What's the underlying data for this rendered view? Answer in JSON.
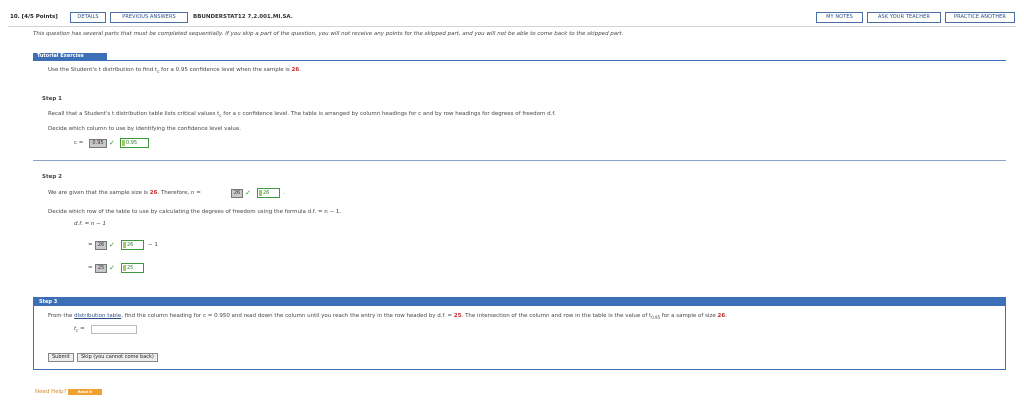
{
  "header": {
    "question_number": "10. [4/5 Points]",
    "details_label": "DETAILS",
    "previous_answers_label": "PREVIOUS ANSWERS",
    "question_id": "BBUNDERSTAT12 7.2.001.MI.SA.",
    "my_notes_label": "MY NOTES",
    "ask_teacher_label": "ASK YOUR TEACHER",
    "practice_another_label": "PRACTICE ANOTHER"
  },
  "notice": "This question has several parts that must be completed sequentially. If you skip a part of the question, you will not receive any points for the skipped part, and you will not be able to come back to the skipped part.",
  "tutorial": {
    "label": "Tutorial Exercise",
    "prompt_prefix": "Use the Student's t distribution to find t",
    "prompt_sub": "c",
    "prompt_mid": " for a 0.95 confidence level when the sample is ",
    "sample": "26",
    "prompt_suffix": "."
  },
  "step1": {
    "title": "Step 1",
    "line1_prefix": "Recall that a Student's t distribution table lists critical values t",
    "line1_sub": "c",
    "line1_suffix": " for a c confidence level. The table is arranged by column headings for c and by row headings for degrees of freedom d.f.",
    "line2": "Decide which column to use by identifying the confidence level value.",
    "c_label": "c =",
    "c_entered": "0.95",
    "c_correct": "0.95"
  },
  "step2": {
    "title": "Step 2",
    "line1_prefix": "We are given that the sample size is ",
    "sample": "26",
    "line1_mid": ". Therefore, n =",
    "n_entered": "26",
    "n_correct": "26",
    "line1_end": ".",
    "line2": "Decide which row of the table to use by calculating the degrees of freedom using the formula d.f. = n − 1.",
    "formula": "d.f. = n − 1",
    "eq_sign": "=",
    "n_entered2": "26",
    "n_correct2": "26",
    "minus_one": "− 1",
    "df_entered": "25",
    "df_correct": "25"
  },
  "step3": {
    "title": "Step 3",
    "line1_prefix": "From the ",
    "link": "distribution table",
    "line1_mid": ", find the column heading for c = 0.950 and read down the column until you reach the entry in the row headed by d.f. = ",
    "df": "25",
    "line1_mid2": ". The intersection of the column and row in the table is the value of t",
    "t_sub": "0.95",
    "line1_mid3": " for a sample of size ",
    "sample": "26",
    "line1_end": ".",
    "tc_label": "t",
    "tc_sub": "c",
    "tc_eq": " =",
    "tc_value": "",
    "submit_label": "Submit",
    "skip_label": "Skip (you cannot come back)"
  },
  "help": {
    "need_help": "Need Help?",
    "read_it": "Read It"
  },
  "colors": {
    "accent": "#3d6fb6",
    "correct": "#2e9b2e",
    "highlight": "#c62828"
  }
}
